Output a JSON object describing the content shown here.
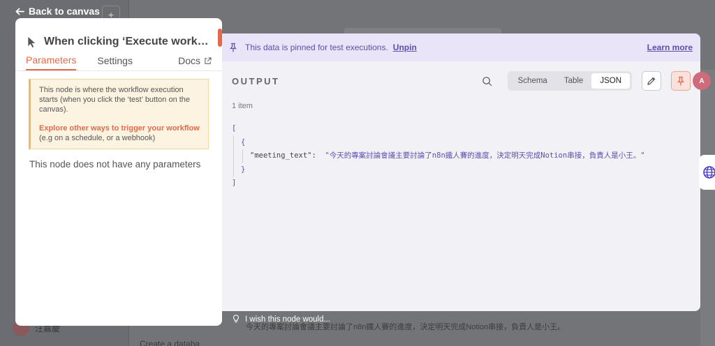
{
  "nav": {
    "back_label": "Back to canvas"
  },
  "node": {
    "title": "When clicking ‘Execute workflo...",
    "tabs": [
      "Parameters",
      "Settings",
      "Docs"
    ],
    "notice_line1": "This node is where the workflow execution starts (when you click the ‘test’ button on the canvas).",
    "notice_link": "Explore other ways to trigger your workflow",
    "notice_suffix": " (e.g on a schedule, or a webhook)",
    "no_params": "This node does not have any parameters"
  },
  "output": {
    "pin_message": "This data is pinned for test executions.",
    "unpin_label": "Unpin",
    "learn_more_label": "Learn more",
    "title": "OUTPUT",
    "views": [
      "Schema",
      "Table",
      "JSON"
    ],
    "active_view": "JSON",
    "item_count": "1 item",
    "json_key": "\"meeting_text\":",
    "json_value": "\"今天的專案討論會議主要討論了n8n鐵人賽的進度，決定明天完成Notion串接，負責人是小王。\""
  },
  "footer": {
    "wish_label": "I wish this node would...",
    "bg_output_text": "今天的專案討論會議主要討論了n8n鐵人賽的進度，決定明天完成Notion串接，負責人是小王。"
  },
  "background": {
    "user_name": "汪嘉慶",
    "create_label": "Create a databa"
  },
  "colors": {
    "accent": "#e26a4a",
    "pin_purple": "#5b4fa8",
    "banner": "#e9e4f7"
  },
  "icons": [
    "arrow-left-icon",
    "cursor-icon",
    "external-link-icon",
    "pin-icon",
    "search-icon",
    "pencil-icon",
    "lightbulb-icon",
    "globe-icon"
  ]
}
